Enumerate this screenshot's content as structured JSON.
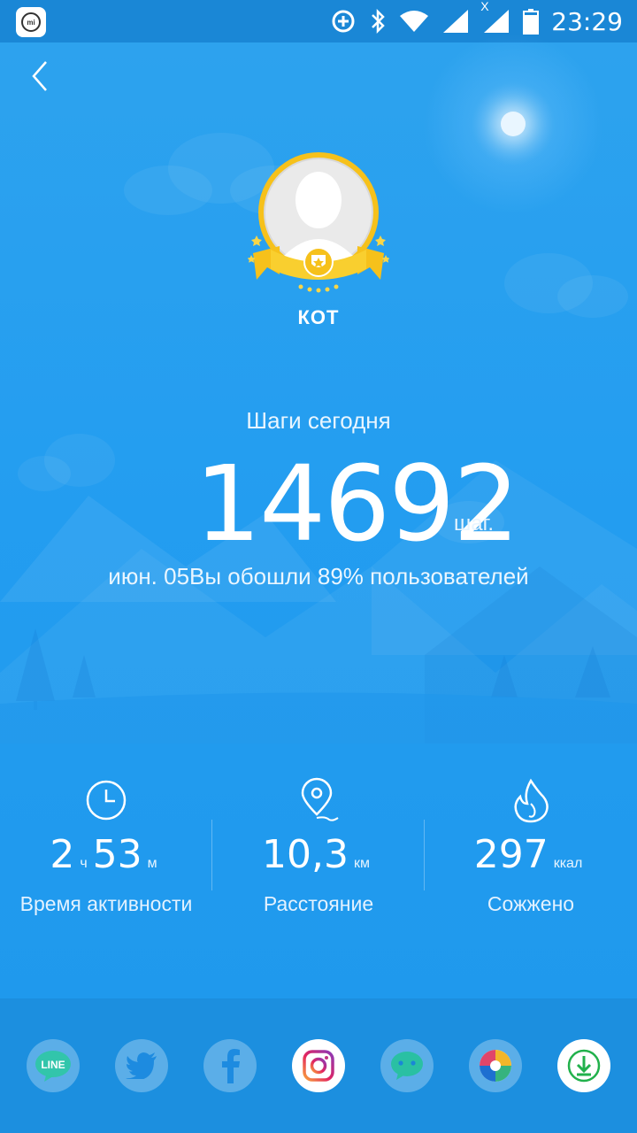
{
  "status_bar": {
    "time": "23:29",
    "network_label": "X"
  },
  "app_icon_text": "mi",
  "profile": {
    "name": "КОТ"
  },
  "steps": {
    "label": "Шаги сегодня",
    "value": "14692",
    "unit": "шаг.",
    "compare": "июн. 05Вы обошли 89% пользователей"
  },
  "stats": {
    "active_time": {
      "hours": "2",
      "hours_unit": "ч",
      "minutes": "53",
      "minutes_unit": "м",
      "label": "Время активности",
      "icon": "clock-icon"
    },
    "distance": {
      "value": "10,3",
      "unit": "км",
      "label": "Расстояние",
      "icon": "location-pin-icon"
    },
    "calories": {
      "value": "297",
      "unit": "ккал",
      "label": "Сожжено",
      "icon": "flame-icon"
    }
  },
  "share": {
    "items": [
      {
        "name": "line",
        "text": "LINE"
      },
      {
        "name": "twitter",
        "text": ""
      },
      {
        "name": "facebook",
        "text": ""
      },
      {
        "name": "instagram",
        "text": ""
      },
      {
        "name": "messenger",
        "text": ""
      },
      {
        "name": "camera-shutter",
        "text": ""
      },
      {
        "name": "download",
        "text": ""
      }
    ]
  },
  "colors": {
    "background": "#239df0",
    "status_bar": "#1a87d6",
    "share_bar": "#1c8fdf",
    "badge_gold": "#f6c11b",
    "download_green": "#22b14c"
  }
}
